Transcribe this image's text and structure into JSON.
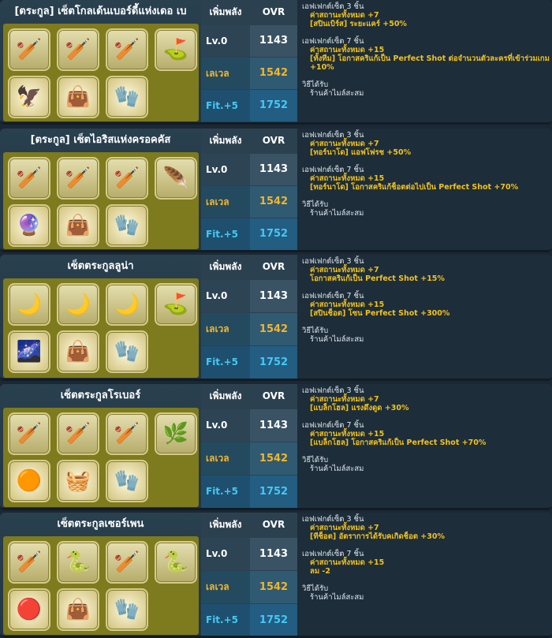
{
  "header_labels": {
    "boost": "เพิ่มพลัง",
    "ovr": "OVR"
  },
  "row_labels": [
    "Lv.0",
    "เลเวลสูงสุด",
    "Fit.+5"
  ],
  "sets": [
    {
      "title": "[ตระกูล] เซ็ตโกลเด้นเบอร์ดี้แห่งเดอ เบ",
      "items": [
        {
          "icon": "golden-wing-club-icon",
          "glyph": "🏏",
          "color": "#c9a236"
        },
        {
          "icon": "golden-wing-club-icon",
          "glyph": "🏏",
          "color": "#c9a236"
        },
        {
          "icon": "golden-wing-club-icon",
          "glyph": "🏏",
          "color": "#c9a236"
        },
        {
          "icon": "golden-putter-icon",
          "glyph": "⛳",
          "color": "#c9a236"
        },
        {
          "icon": "golden-eagle-ball-icon",
          "glyph": "🦅",
          "color": "#d7a51c"
        },
        {
          "icon": "golden-bag-icon",
          "glyph": "👜",
          "color": "#a4301a"
        },
        {
          "icon": "golden-glove-icon",
          "glyph": "🧤",
          "color": "#b6291d"
        }
      ],
      "values": [
        "1143",
        "1542",
        "1752"
      ],
      "effects": [
        {
          "head": "เอฟเฟกต์เซ็ต 3 ชิ้น",
          "lines": [
            "ค่าสถานะทั้งหมด +7",
            "[สปินเบิร์ส] ระยะแคร์ +50%"
          ]
        },
        {
          "head": "เอฟเฟกต์เซ็ต 7 ชิ้น",
          "lines": [
            "ค่าสถานะทั้งหมด +15",
            "[ทั้งทีม] โอกาสคริแก้เป็น Perfect Shot ต่อจำนวนตัวละครที่เข้าร่วมเกม +10%"
          ]
        }
      ],
      "source_head": "วิธีได้รับ",
      "source": "ร้านค้าไมล์สะสม"
    },
    {
      "title": "[ตระกูล] เซ็ตไอริสแห่งครอคคัส",
      "items": [
        {
          "icon": "iris-crystal-club-icon",
          "glyph": "🏏",
          "color": "#c9a236"
        },
        {
          "icon": "iris-crystal-club-icon",
          "glyph": "🏏",
          "color": "#c9a236"
        },
        {
          "icon": "iris-crystal-club-icon",
          "glyph": "🏏",
          "color": "#c9a236"
        },
        {
          "icon": "iris-putter-icon",
          "glyph": "🪶",
          "color": "#b46fd3"
        },
        {
          "icon": "iris-purple-ball-icon",
          "glyph": "🔮",
          "color": "#6b3fb5"
        },
        {
          "icon": "iris-bag-icon",
          "glyph": "👜",
          "color": "#8c78c8"
        },
        {
          "icon": "iris-glove-icon",
          "glyph": "🧤",
          "color": "#8f7bcf"
        }
      ],
      "values": [
        "1143",
        "1542",
        "1752"
      ],
      "effects": [
        {
          "head": "เอฟเฟกต์เซ็ต 3 ชิ้น",
          "lines": [
            "ค่าสถานะทั้งหมด +7",
            "[ทอร์นาโด] แอฟโฟรช +50%"
          ]
        },
        {
          "head": "เอฟเฟกต์เซ็ต 7 ชิ้น",
          "lines": [
            "ค่าสถานะทั้งหมด +15",
            "[ทอร์นาโด] โอกาสคริแก้ช็อตต่อไปเป็น Perfect Shot +70%"
          ]
        }
      ],
      "source_head": "วิธีได้รับ",
      "source": "ร้านค้าไมล์สะสม"
    },
    {
      "title": "เซ็ตตระกูลลูน่า",
      "items": [
        {
          "icon": "luna-moon-club-icon",
          "glyph": "🌙",
          "color": "#e1d9c8"
        },
        {
          "icon": "luna-moon-club-icon",
          "glyph": "🌙",
          "color": "#e1d9c8"
        },
        {
          "icon": "luna-moon-club-icon",
          "glyph": "🌙",
          "color": "#e1d9c8"
        },
        {
          "icon": "luna-putter-icon",
          "glyph": "⛳",
          "color": "#e1d9c8"
        },
        {
          "icon": "luna-night-ball-icon",
          "glyph": "🌌",
          "color": "#2b2f7a"
        },
        {
          "icon": "luna-bag-icon",
          "glyph": "👜",
          "color": "#3b4a88"
        },
        {
          "icon": "luna-glove-icon",
          "glyph": "🧤",
          "color": "#5468a4"
        }
      ],
      "values": [
        "1143",
        "1542",
        "1752"
      ],
      "effects": [
        {
          "head": "เอฟเฟกต์เซ็ต 3 ชิ้น",
          "lines": [
            "ค่าสถานะทั้งหมด +7",
            "โอกาสคริแก้เป็น Perfect Shot +15%"
          ]
        },
        {
          "head": "เอฟเฟกต์เซ็ต 7 ชิ้น",
          "lines": [
            "ค่าสถานะทั้งหมด +15",
            "[สปินช็อต] โซน Perfect Shot +300%"
          ]
        }
      ],
      "source_head": "วิธีได้รับ",
      "source": "ร้านค้าไมล์สะสม"
    },
    {
      "title": "เซ็ตตระกูลโรเบอร์",
      "items": [
        {
          "icon": "rover-wood-club-icon",
          "glyph": "🏏",
          "color": "#6f3b12"
        },
        {
          "icon": "rover-wood-club-icon",
          "glyph": "🏏",
          "color": "#6f3b12"
        },
        {
          "icon": "rover-wood-club-icon",
          "glyph": "🏏",
          "color": "#6f3b12"
        },
        {
          "icon": "rover-putter-icon",
          "glyph": "🌿",
          "color": "#4f7a2a"
        },
        {
          "icon": "rover-orange-ball-icon",
          "glyph": "🟠",
          "color": "#d36b16"
        },
        {
          "icon": "rover-bag-icon",
          "glyph": "🧺",
          "color": "#7a4b1c"
        },
        {
          "icon": "rover-glove-icon",
          "glyph": "🧤",
          "color": "#8a5a22"
        }
      ],
      "values": [
        "1143",
        "1542",
        "1752"
      ],
      "effects": [
        {
          "head": "เอฟเฟกต์เซ็ต 3 ชิ้น",
          "lines": [
            "ค่าสถานะทั้งหมด +7",
            "[แบล็กโฮล] แรงดึงดูด +30%"
          ]
        },
        {
          "head": "เอฟเฟกต์เซ็ต 7 ชิ้น",
          "lines": [
            "ค่าสถานะทั้งหมด +15",
            "[แบล็กโฮล] โอกาสคริแก้เป็น Perfect Shot +70%"
          ]
        }
      ],
      "source_head": "วิธีได้รับ",
      "source": "ร้านค้าไมล์สะสม"
    },
    {
      "title": "เซ็ตตระกูลเซอร์เพน",
      "items": [
        {
          "icon": "serpent-gem-club-icon",
          "glyph": "🏏",
          "color": "#9b2fb0"
        },
        {
          "icon": "serpent-gem-club-icon",
          "glyph": "🐍",
          "color": "#c0c8d8"
        },
        {
          "icon": "serpent-gem-club-icon",
          "glyph": "🏏",
          "color": "#c0c8d8"
        },
        {
          "icon": "serpent-putter-icon",
          "glyph": "🐍",
          "color": "#c0c8d8"
        },
        {
          "icon": "serpent-red-ball-icon",
          "glyph": "🔴",
          "color": "#b3222b"
        },
        {
          "icon": "serpent-bag-icon",
          "glyph": "👜",
          "color": "#4a4a55"
        },
        {
          "icon": "serpent-glove-icon",
          "glyph": "🧤",
          "color": "#5b3d3d"
        }
      ],
      "values": [
        "1143",
        "1542",
        "1752"
      ],
      "effects": [
        {
          "head": "เอฟเฟกต์เซ็ต 3 ชิ้น",
          "lines": [
            "ค่าสถานะทั้งหมด +7",
            "[ทีช็อต] อัตราการได้รับคเกิดช็อต +30%"
          ]
        },
        {
          "head": "เอฟเฟกต์เซ็ต 7 ชิ้น",
          "lines": [
            "ค่าสถานะทั้งหมด +15",
            "ลม -2"
          ]
        }
      ],
      "source_head": "วิธีได้รับ",
      "source": "ร้านค้าไมล์สะสม"
    }
  ],
  "colors": {
    "gold": "#f3b52c",
    "cyan": "#45c8f4",
    "effect": "#f2c21d"
  }
}
